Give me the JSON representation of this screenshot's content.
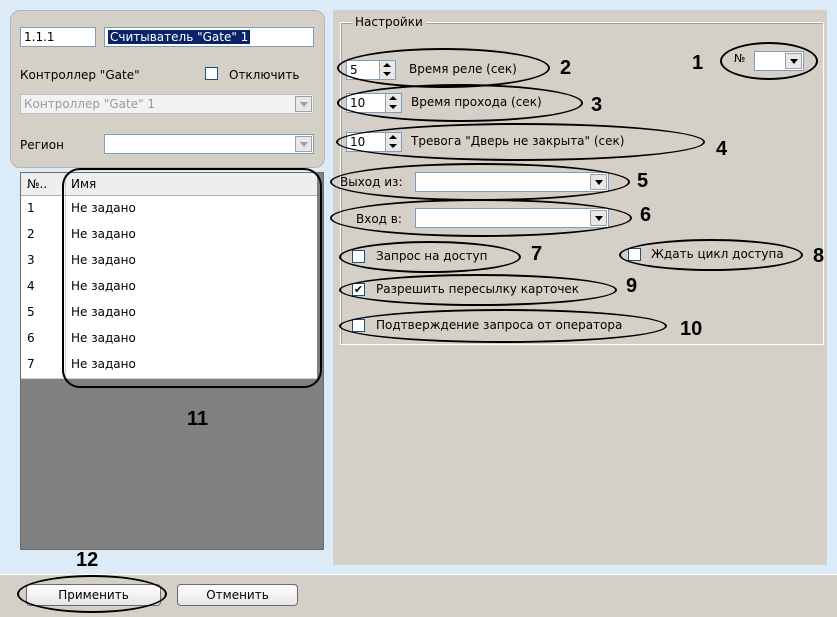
{
  "reader": {
    "id": "1.1.1",
    "name": "Считыватель \"Gate\" 1",
    "controller_label": "Контроллер \"Gate\"",
    "disable_label": "Отключить",
    "controller_value": "Контроллер \"Gate\" 1",
    "region_label": "Регион",
    "region_value": ""
  },
  "list": {
    "col_no": "№..",
    "col_name": "Имя",
    "rows": [
      {
        "no": "1",
        "name": "Не задано"
      },
      {
        "no": "2",
        "name": "Не задано"
      },
      {
        "no": "3",
        "name": "Не задано"
      },
      {
        "no": "4",
        "name": "Не задано"
      },
      {
        "no": "5",
        "name": "Не задано"
      },
      {
        "no": "6",
        "name": "Не задано"
      },
      {
        "no": "7",
        "name": "Не задано"
      }
    ]
  },
  "settings": {
    "group_title": "Настройки",
    "relay_time_value": "5",
    "relay_time_label": "Время реле (сек)",
    "pass_time_value": "10",
    "pass_time_label": "Время прохода (сек)",
    "alarm_value": "10",
    "alarm_label": "Тревога \"Дверь не закрыта\" (сек)",
    "no_label": "№",
    "no_value": "",
    "exit_from_label": "Выход из:",
    "exit_from_value": "",
    "entry_to_label": "Вход в:",
    "entry_to_value": "",
    "access_request_label": "Запрос на доступ",
    "access_request_checked": false,
    "wait_cycle_label": "Ждать цикл доступа",
    "wait_cycle_checked": false,
    "allow_forward_label": "Разрешить пересылку карточек",
    "allow_forward_checked": true,
    "operator_confirm_label": "Подтверждение запроса от оператора",
    "operator_confirm_checked": false
  },
  "buttons": {
    "apply": "Применить",
    "cancel": "Отменить"
  },
  "annotations": {
    "n1": "1",
    "n2": "2",
    "n3": "3",
    "n4": "4",
    "n5": "5",
    "n6": "6",
    "n7": "7",
    "n8": "8",
    "n9": "9",
    "n10": "10",
    "n11": "11",
    "n12": "12"
  }
}
